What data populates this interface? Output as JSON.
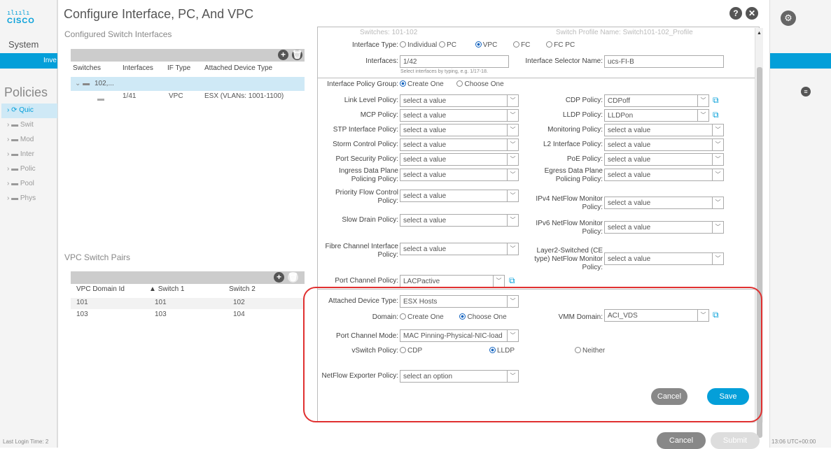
{
  "bg": {
    "logo_text": "CISCO",
    "system": "System",
    "strip_label": "Inve",
    "policies": "Policies",
    "nav": [
      "Quic",
      "Swit",
      "Mod",
      "Inter",
      "Polic",
      "Pool",
      "Phys"
    ],
    "footer_left": "Last Login Time: 2",
    "footer_right": "13:06 UTC+00:00"
  },
  "dialog": {
    "title": "Configure Interface, PC, And VPC",
    "help_icon": "?",
    "close_icon": "✕"
  },
  "switch_interfaces": {
    "title": "Configured Switch Interfaces",
    "headers": [
      "Switches",
      "Interfaces",
      "IF Type",
      "Attached Device Type"
    ],
    "group_label": "102,...",
    "row": {
      "interfaces": "1/41",
      "if_type": "VPC",
      "device": "ESX (VLANs: 1001-1100)"
    }
  },
  "vpc_pairs": {
    "title": "VPC Switch Pairs",
    "headers": [
      "VPC Domain Id",
      "Switch 1",
      "Switch 2"
    ],
    "rows": [
      {
        "domain": "101",
        "s1": "101",
        "s2": "102"
      },
      {
        "domain": "103",
        "s1": "103",
        "s2": "104"
      }
    ]
  },
  "form": {
    "top_faded": {
      "switches": "Switches: 101-102",
      "profile": "Switch Profile Name: Switch101-102_Profile"
    },
    "interface_type": {
      "label": "Interface Type:",
      "options": [
        "Individual",
        "PC",
        "VPC",
        "FC",
        "FC PC"
      ],
      "selected": "VPC"
    },
    "interfaces": {
      "label": "Interfaces:",
      "value": "1/42",
      "hint": "Select interfaces by typing, e.g. 1/17-18."
    },
    "selector_name": {
      "label": "Interface Selector Name:",
      "value": "ucs-FI-B"
    },
    "policy_group": {
      "label": "Interface Policy Group:",
      "options": [
        "Create One",
        "Choose One"
      ],
      "selected": "Create One"
    },
    "placeholder": "select a value",
    "left_policies": [
      {
        "label": "Link Level Policy:",
        "value": "select a value"
      },
      {
        "label": "MCP Policy:",
        "value": "select a value"
      },
      {
        "label": "STP Interface Policy:",
        "value": "select a value"
      },
      {
        "label": "Storm Control Policy:",
        "value": "select a value"
      },
      {
        "label": "Port Security Policy:",
        "value": "select a value"
      },
      {
        "label_1": "Ingress Data Plane",
        "label_2": "Policing Policy:",
        "value": "select a value"
      },
      {
        "label_1": "Priority Flow Control",
        "label_2": "Policy:",
        "value": "select a value"
      },
      {
        "label": "Slow Drain Policy:",
        "value": "select a value"
      },
      {
        "label_1": "Fibre Channel Interface",
        "label_2": "Policy:",
        "value": "select a value"
      },
      {
        "label": "Port Channel Policy:",
        "value": "LACPactive"
      }
    ],
    "right_policies": [
      {
        "label": "CDP Policy:",
        "value": "CDPoff"
      },
      {
        "label": "LLDP Policy:",
        "value": "LLDPon"
      },
      {
        "label": "Monitoring Policy:",
        "value": "select a value"
      },
      {
        "label": "L2 Interface Policy:",
        "value": "select a value"
      },
      {
        "label": "PoE Policy:",
        "value": "select a value"
      },
      {
        "label_1": "Egress Data Plane",
        "label_2": "Policing Policy:",
        "value": "select a value"
      },
      {
        "label_1": "IPv4 NetFlow Monitor",
        "label_2": "Policy:",
        "value": "select a value"
      },
      {
        "label_1": "IPv6 NetFlow Monitor",
        "label_2": "Policy:",
        "value": "select a value"
      },
      {
        "label_1": "Layer2-Switched (CE",
        "label_2": "type) NetFlow Monitor",
        "label_3": "Policy:",
        "value": "select a value"
      }
    ],
    "attached_device": {
      "label": "Attached Device Type:",
      "value": "ESX Hosts"
    },
    "domain": {
      "label": "Domain:",
      "options": [
        "Create One",
        "Choose One"
      ],
      "selected": "Choose One"
    },
    "vmm_domain": {
      "label": "VMM Domain:",
      "value": "ACI_VDS"
    },
    "port_channel_mode": {
      "label": "Port Channel Mode:",
      "value": "MAC Pinning-Physical-NIC-load"
    },
    "vswitch_policy": {
      "label": "vSwitch Policy:",
      "options": [
        "CDP",
        "LLDP",
        "Neither"
      ],
      "selected": "LLDP"
    },
    "netflow_exporter": {
      "label": "NetFlow Exporter Policy:",
      "value": "select an option"
    },
    "cancel": "Cancel",
    "save": "Save"
  },
  "footer": {
    "cancel": "Cancel",
    "submit": "Submit"
  },
  "colors": {
    "accent": "#049fd9",
    "highlight": "#e03030",
    "selected_row": "#cfe9f6"
  }
}
